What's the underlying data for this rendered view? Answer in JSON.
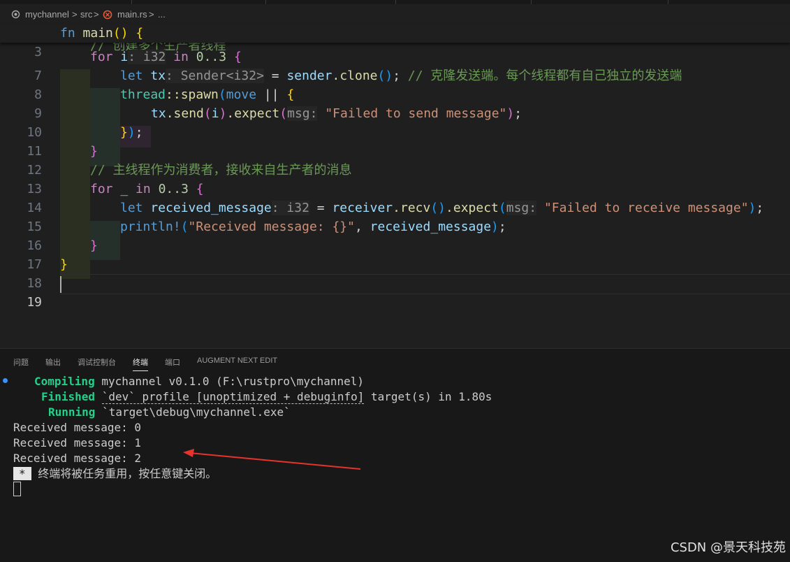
{
  "breadcrumb": {
    "folder": "mychannel",
    "sep": ">",
    "sub": "src",
    "file": "main.rs",
    "more": "..."
  },
  "editor": {
    "sticky": {
      "num": "3",
      "kw": "fn",
      "name": "main",
      "rest": "() {"
    },
    "partial_line_comment": "// 创建多个生产者线程",
    "lines": [
      {
        "num": "7"
      },
      {
        "num": "8"
      },
      {
        "num": "9"
      },
      {
        "num": "10"
      },
      {
        "num": "11"
      },
      {
        "num": "12"
      },
      {
        "num": "13"
      },
      {
        "num": "14"
      },
      {
        "num": "15"
      },
      {
        "num": "16"
      },
      {
        "num": "17"
      },
      {
        "num": "18"
      },
      {
        "num": "19"
      }
    ],
    "tokens": {
      "for": "for",
      "i": "i",
      "i32hint": ": i32",
      "in": "in",
      "range1": "0..3",
      "let": "let",
      "tx": "tx",
      "senderhint": ": Sender<i32>",
      "eq": " = ",
      "sender": "sender",
      "clone": ".clone",
      "comment8": "// 克隆发送端。每个线程都有自己独立的发送端",
      "thread": "thread",
      "spawn": "::spawn",
      "move": "move",
      "pipes": " || ",
      "send": ".send",
      "expect": ".expect",
      "msghint": "msg:",
      "str10": "\"Failed to send message\"",
      "comment13": "// 主线程作为消费者，接收来自生产者的消息",
      "underscore": "_",
      "received_message": "received_message",
      "receiver": "receiver",
      "recv": ".recv",
      "str15": "\"Failed to receive message\"",
      "println": "println!",
      "str16": "\"Received message: {}\""
    }
  },
  "panel": {
    "tabs": [
      "问题",
      "输出",
      "调试控制台",
      "终端",
      "端口",
      "AUGMENT NEXT EDIT"
    ],
    "active_tab": "终端"
  },
  "terminal": {
    "compiling_label": "Compiling",
    "compiling_text": " mychannel v0.1.0 (F:\\rustpro\\mychannel)",
    "finished_label": "Finished",
    "finished_text_a": "`dev` profile [unoptimized + debuginfo]",
    "finished_text_b": " target(s) in 1.80s",
    "running_label": "Running",
    "running_text": " `target\\debug\\mychannel.exe`",
    "outputs": [
      "Received message: 0",
      "Received message: 1",
      "Received message: 2"
    ],
    "star": "*",
    "reuse_msg": " 终端将被任务重用，按任意键关闭。"
  },
  "watermark": "CSDN @景天科技苑",
  "colors": {
    "arrow": "#e8322d",
    "accent": "#3794ff"
  }
}
